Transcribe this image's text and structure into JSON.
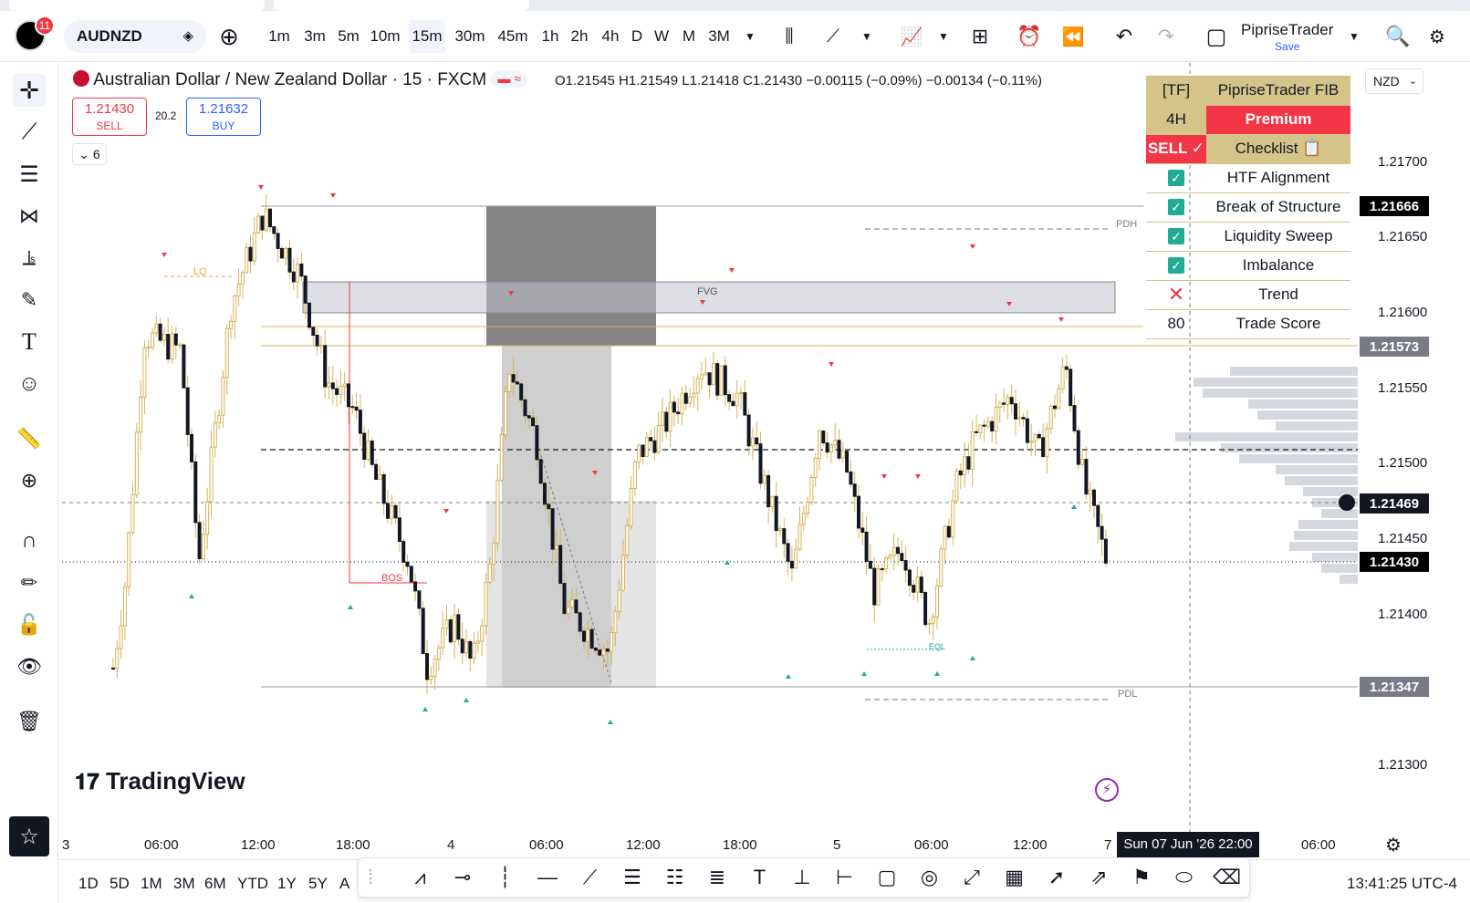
{
  "notifications": {
    "count": "11"
  },
  "symbol": "AUDNZD",
  "intervals": [
    "1m",
    "3m",
    "5m",
    "10m",
    "15m",
    "30m",
    "45m",
    "1h",
    "2h",
    "4h",
    "D",
    "W",
    "M",
    "3M"
  ],
  "active_interval": "15m",
  "account": {
    "name": "PipriseTrader",
    "save_label": "Save"
  },
  "legend": {
    "title": "Australian Dollar / New Zealand Dollar · 15 · FXCM",
    "ohlc": "O1.21545  H1.21549  L1.21418  C1.21430  −0.00115 (−0.09%)  −0.00134 (−0.11%)"
  },
  "trade": {
    "sell_price": "1.21430",
    "sell_label": "SELL",
    "spread": "20.2",
    "buy_price": "1.21632",
    "buy_label": "BUY",
    "indicators_count": "6"
  },
  "currency_selector": "NZD",
  "checklist": {
    "header_left": "[TF]",
    "header_right": "PipriseTrader FIB",
    "tf": "4H",
    "tier": "Premium",
    "signal": "SELL ✓",
    "checklist_label": "Checklist 📋",
    "items": [
      {
        "label": "HTF Alignment",
        "status": "check"
      },
      {
        "label": "Break of Structure",
        "status": "check"
      },
      {
        "label": "Liquidity Sweep",
        "status": "check"
      },
      {
        "label": "Imbalance",
        "status": "check"
      },
      {
        "label": "Trend",
        "status": "cross"
      }
    ],
    "score": "80",
    "score_label": "Trade Score"
  },
  "chart_labels": {
    "lq": "LQ",
    "fvg": "FVG",
    "bos": "BOS",
    "pdh": "PDH",
    "pdl": "PDL",
    "eql": "EQL"
  },
  "price_scale": {
    "labels": [
      "1.21700",
      "1.21650",
      "1.21600",
      "1.21550",
      "1.21500",
      "1.21450",
      "1.21400",
      "1.21300"
    ],
    "tags": [
      {
        "value": "1.21666",
        "color": "#000000"
      },
      {
        "value": "1.21573",
        "color": "#787b86"
      },
      {
        "value": "1.21469",
        "color": "#131722"
      },
      {
        "value": "1.21430",
        "color": "#000000"
      },
      {
        "value": "1.21347",
        "color": "#787b86"
      }
    ]
  },
  "time_scale": {
    "labels": [
      "3",
      "06:00",
      "12:00",
      "18:00",
      "4",
      "06:00",
      "12:00",
      "18:00",
      "5",
      "06:00",
      "12:00",
      "7",
      "06:00"
    ],
    "crosshair_time": "Sun 07 Jun '26   22:00"
  },
  "bottom": {
    "ranges": [
      "1D",
      "5D",
      "1M",
      "3M",
      "6M",
      "YTD",
      "1Y",
      "5Y",
      "A"
    ],
    "clock": "13:41:25 UTC-4"
  },
  "watermark": "TradingView",
  "colors": {
    "sell": "#f23645",
    "buy": "#2962ff",
    "gold": "#d4b45a",
    "premium": "#f23645",
    "check": "#22ab94"
  }
}
